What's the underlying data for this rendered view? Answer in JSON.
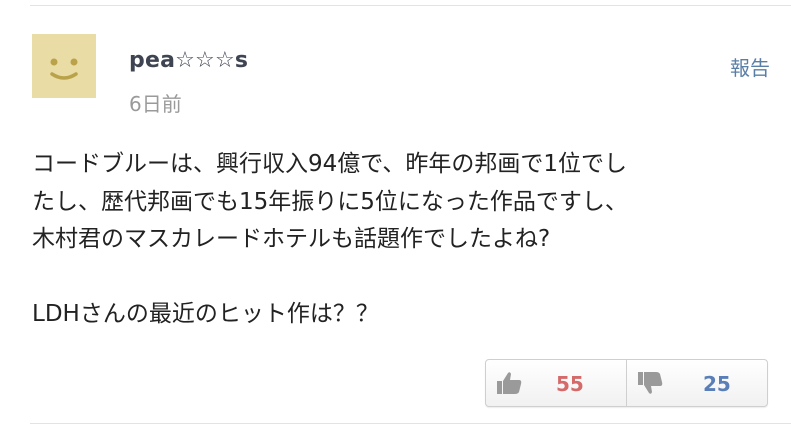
{
  "comment": {
    "user": "pea☆☆☆s",
    "time": "6日前",
    "report_label": "報告",
    "lines": [
      "コードブルーは、興行収入94億で、昨年の邦画で1位でし",
      "たし、歴代邦画でも15年振りに5位になった作品ですし、",
      "木村君のマスカレードホテルも話題作でしたよね?",
      "LDHさんの最近のヒット作は？？"
    ],
    "votes": {
      "up_icon": "thumbs-up-icon",
      "up_count": "55",
      "down_icon": "thumbs-down-icon",
      "down_count": "25"
    }
  },
  "colors": {
    "avatar_bg": "#e9dca4",
    "avatar_face": "#b9a24a",
    "report": "#5a7fa6",
    "up_count": "#d46a6a",
    "down_count": "#5a7fb8"
  }
}
